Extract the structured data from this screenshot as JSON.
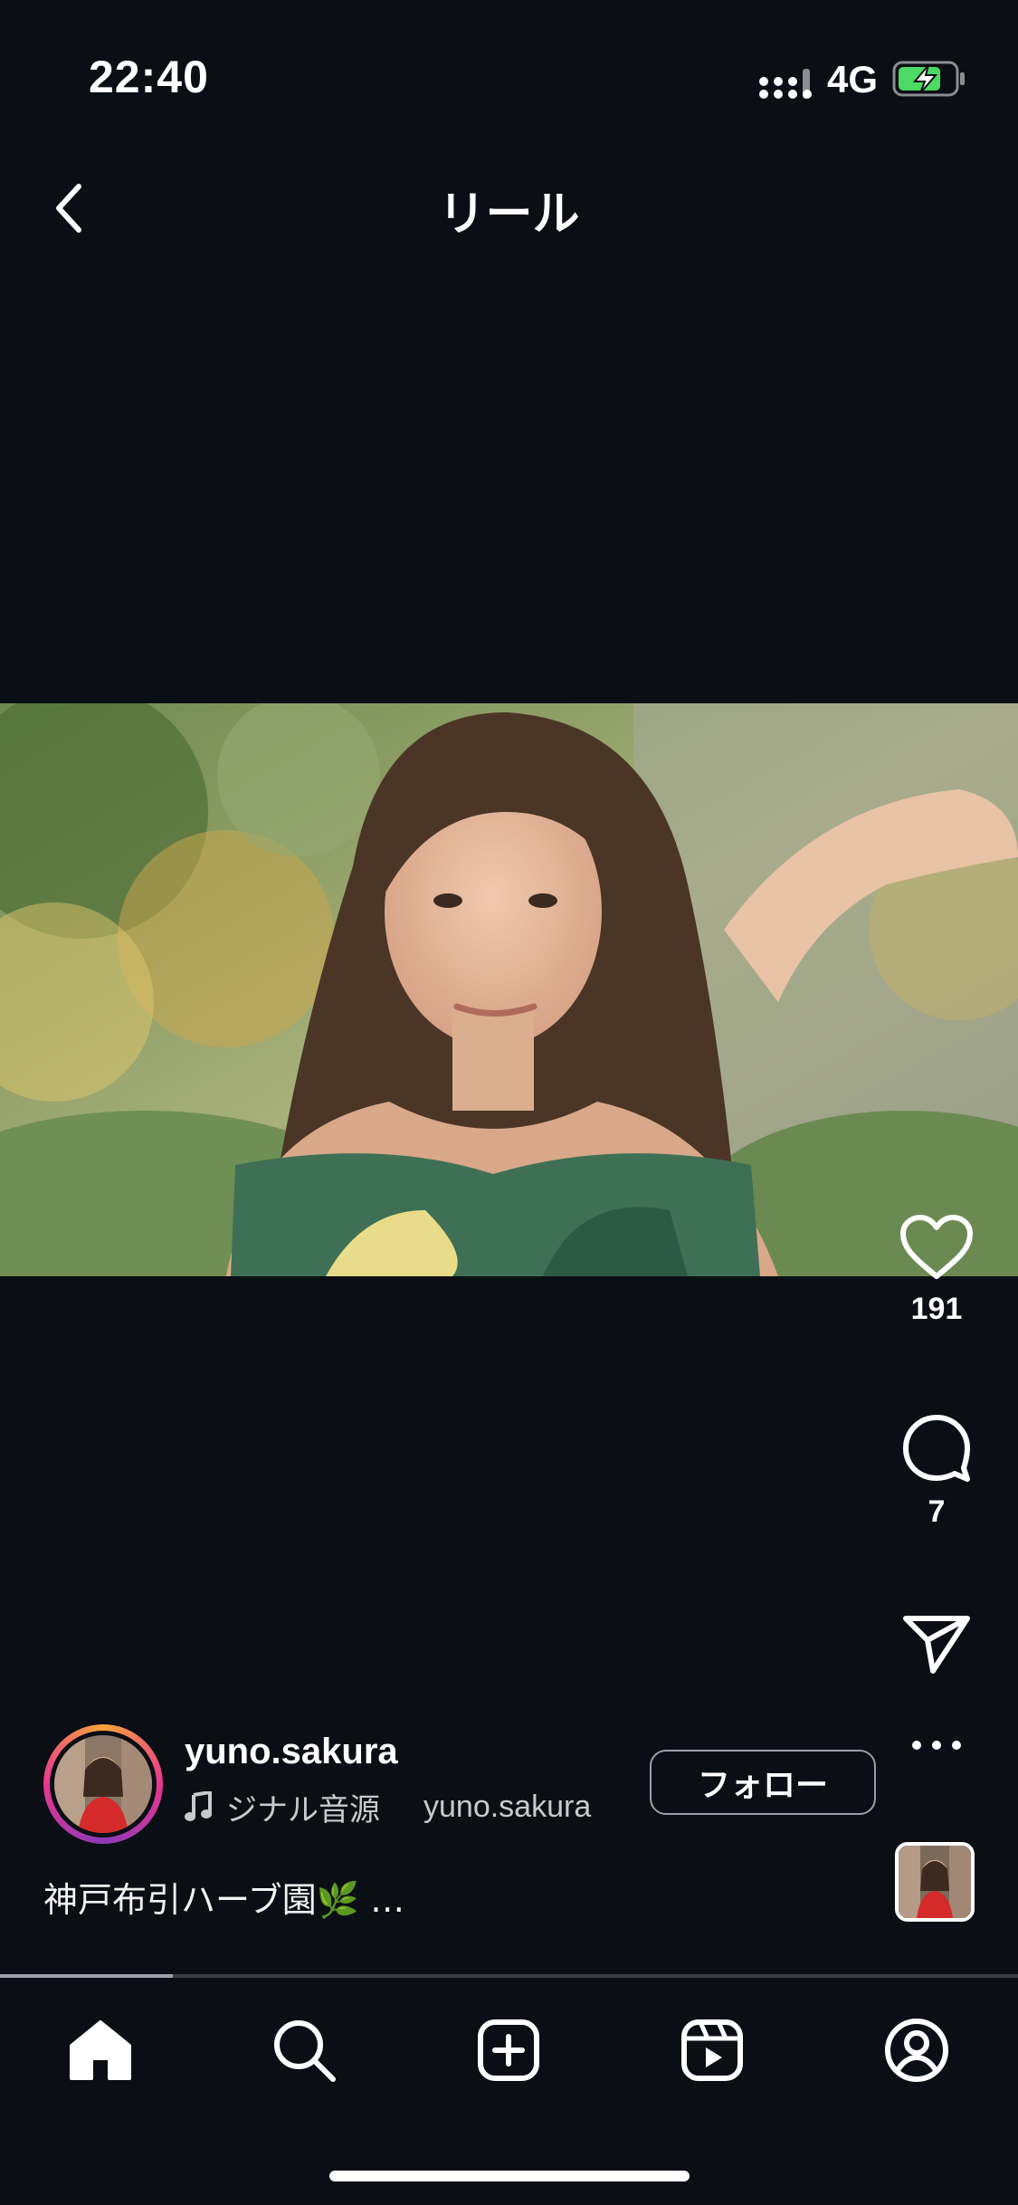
{
  "status_bar": {
    "time": "22:40",
    "network": "4G"
  },
  "header": {
    "title": "リール"
  },
  "actions": {
    "like_count": "191",
    "comment_count": "7"
  },
  "author": {
    "username": "yuno.sakura",
    "audio_title": "ジナル音源",
    "audio_artist": "yuno.sakura",
    "follow_label": "フォロー"
  },
  "caption": {
    "text": "神戸布引ハーブ園🌿 …"
  },
  "playback": {
    "progress": 0.17
  },
  "colors": {
    "background": "#0b0e14",
    "battery_fill": "#4cd964",
    "story_ring": "#e8378f"
  }
}
